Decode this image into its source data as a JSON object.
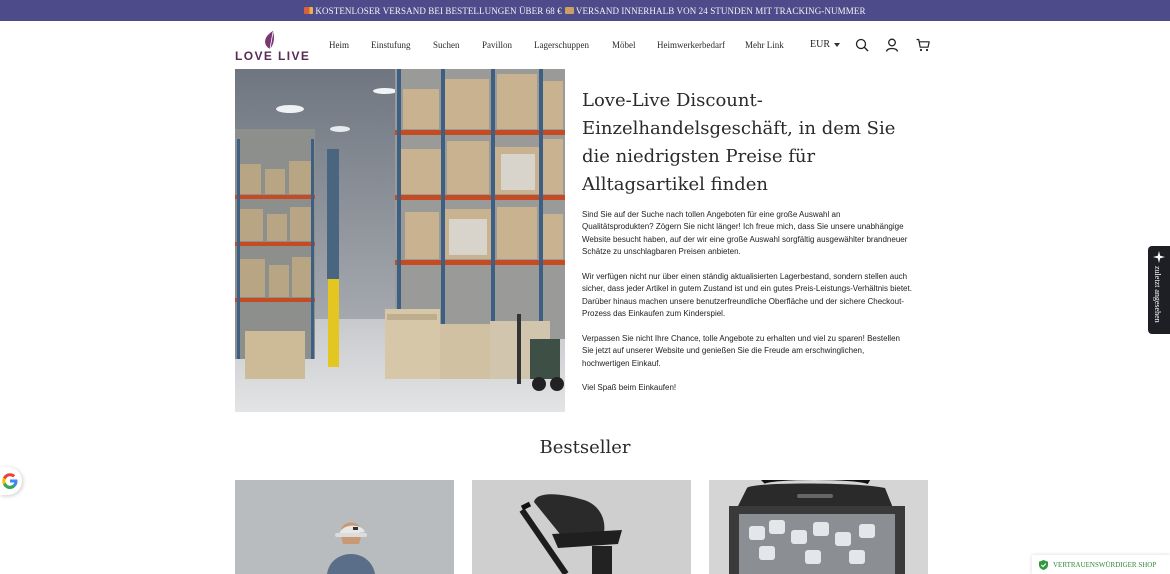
{
  "announcement": {
    "text": "KOSTENLOSER VERSAND BEI BESTELLUNGEN ÜBER 68 € ",
    "text2": "VERSAND INNERHALB VON 24 STUNDEN MIT TRACKING-NUMMER"
  },
  "brand": {
    "logo_text": "LOVE LIVE",
    "accent": "#7a3573"
  },
  "nav": {
    "items": [
      {
        "label": "Heim"
      },
      {
        "label": "Einstufung"
      },
      {
        "label": "Suchen"
      },
      {
        "label": "Pavillon"
      },
      {
        "label": "Lagerschuppen"
      },
      {
        "label": "Möbel"
      },
      {
        "label": "Heimwerkerbedarf"
      },
      {
        "label": "Mehr Link"
      }
    ],
    "currency": "EUR"
  },
  "icons": [
    "search-icon",
    "account-icon",
    "cart-icon",
    "sparkle-icon",
    "google-icon",
    "shield-check-icon"
  ],
  "hero": {
    "title": "Love-Live Discount-Einzelhandelsgeschäft, in dem Sie die niedrigsten Preise für Alltagsartikel finden",
    "paragraphs": [
      "Sind Sie auf der Suche nach tollen Angeboten für eine große Auswahl an Qualitätsprodukten? Zögern Sie nicht länger! Ich freue mich, dass Sie unsere unabhängige Website besucht haben, auf der wir eine große Auswahl sorgfältig ausgewählter brandneuer Schätze zu unschlagbaren Preisen anbieten.",
      "Wir verfügen nicht nur über einen ständig aktualisierten Lagerbestand, sondern stellen auch sicher, dass jeder Artikel in gutem Zustand ist und ein gutes Preis-Leistungs-Verhältnis bietet. Darüber hinaus machen unsere benutzerfreundliche Oberfläche und der sichere Checkout-Prozess das Einkaufen zum Kinderspiel.",
      "Verpassen Sie nicht Ihre Chance, tolle Angebote zu erhalten und viel zu sparen! Bestellen Sie jetzt auf unserer Website und genießen Sie die Freude am erschwinglichen, hochwertigen Einkauf.",
      "Viel Spaß beim Einkaufen!"
    ]
  },
  "bestseller": {
    "title": "Bestseller"
  },
  "side_tab": {
    "label": "zuletzt angesehen"
  },
  "trust_badge": {
    "label": "VERTRAUENSWÜRDIGER SHOP"
  }
}
